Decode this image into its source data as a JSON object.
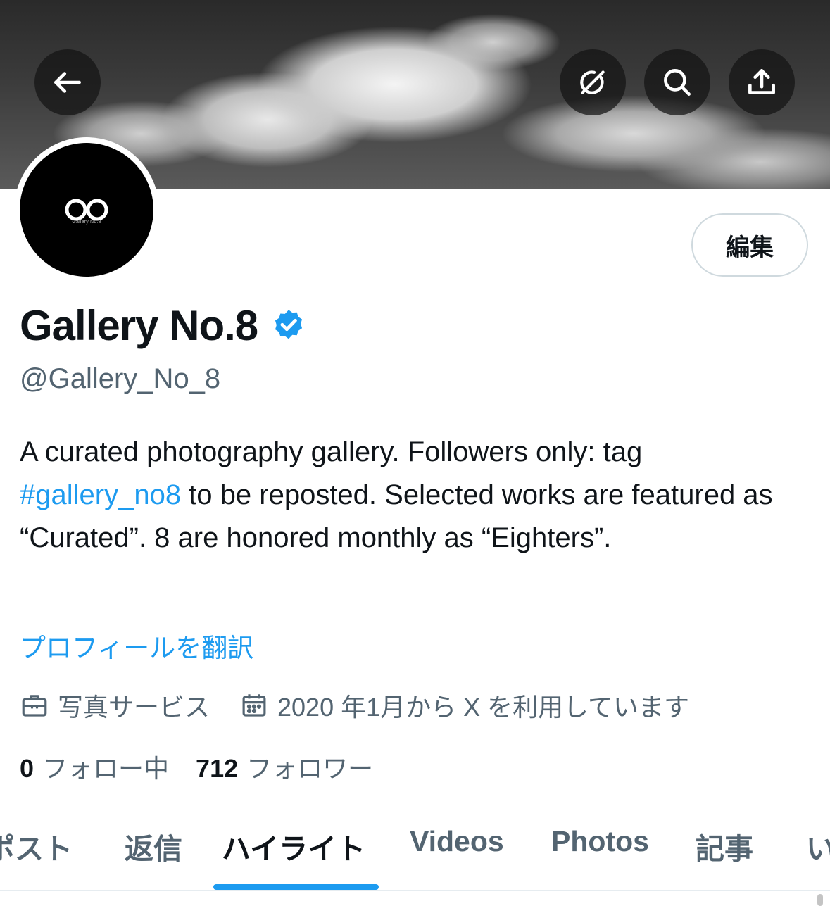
{
  "header": {
    "back_icon": "arrow-left-icon",
    "grok_icon": "grok-icon",
    "search_icon": "search-icon",
    "share_icon": "share-icon"
  },
  "profile": {
    "avatar_sub": "Gallery No.8",
    "edit_label": "編集",
    "name": "Gallery No.8",
    "handle": "@Gallery_No_8",
    "bio_part1": "A curated photography gallery. Followers only: tag ",
    "bio_hashtag": "#gallery_no8",
    "bio_part2": " to be reposted. Selected works are featured as “Curated”. 8 are honored monthly as “Eighters”.",
    "translate_label": "プロフィールを翻訳",
    "category": "写真サービス",
    "joined": "2020 年1月から X を利用しています",
    "following_count": "0",
    "following_label": "フォロー中",
    "followers_count": "712",
    "followers_label": "フォロワー"
  },
  "tabs": [
    {
      "label": "ポスト"
    },
    {
      "label": "返信"
    },
    {
      "label": "ハイライト"
    },
    {
      "label": "Videos"
    },
    {
      "label": "Photos"
    },
    {
      "label": "記事"
    },
    {
      "label": "い"
    }
  ],
  "active_tab": "ハイライト",
  "colors": {
    "accent": "#1d9bf0",
    "text_primary": "#0f1419",
    "text_secondary": "#536471"
  }
}
